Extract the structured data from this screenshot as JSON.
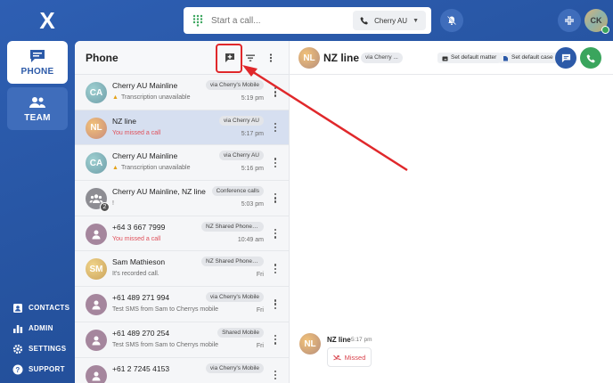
{
  "app": {
    "logo_glyph": "X",
    "accent": "#2c5aa8",
    "missed_color": "#e0505a",
    "call_green": "#3aa55d"
  },
  "nav": {
    "phone_label": "PHONE",
    "team_label": "TEAM",
    "contacts_label": "CONTACTS",
    "admin_label": "ADMIN",
    "settings_label": "SETTINGS",
    "support_label": "SUPPORT"
  },
  "topbar": {
    "search_placeholder": "Start a call...",
    "line_selector": "Cherry AU",
    "user_initials": "CK"
  },
  "phone_list": {
    "title": "Phone",
    "rows": [
      {
        "initials": "CA",
        "name": "Cherry AU Mainline",
        "tag": "via Cherry's Mobile",
        "subtitle": "Transcription unavailable",
        "time": "5:19 pm",
        "warning": true,
        "missed": false
      },
      {
        "initials": "NL",
        "name": "NZ line",
        "tag": "via Cherry AU",
        "subtitle": "You missed a call",
        "time": "5:17 pm",
        "warning": false,
        "missed": true
      },
      {
        "initials": "CA",
        "name": "Cherry AU Mainline",
        "tag": "via Cherry AU",
        "subtitle": "Transcription unavailable",
        "time": "5:16 pm",
        "warning": true,
        "missed": false
      },
      {
        "initials": "",
        "name": "Cherry AU Mainline, NZ line",
        "tag": "Conference calls",
        "subtitle": "!",
        "time": "5:03 pm",
        "warning": false,
        "missed": false,
        "badge": "2"
      },
      {
        "initials": "",
        "name": "+64 3 667 7999",
        "tag": "NZ Shared Phone Te...",
        "subtitle": "You missed a call",
        "time": "10:49 am",
        "warning": false,
        "missed": true
      },
      {
        "initials": "SM",
        "name": "Sam Mathieson",
        "tag": "NZ Shared Phone Te...",
        "subtitle": "It's recorded call.",
        "time": "Fri",
        "warning": false,
        "missed": false
      },
      {
        "initials": "",
        "name": "+61 489 271 994",
        "tag": "via Cherry's Mobile",
        "subtitle": "Test SMS from Sam to Cherrys mobile",
        "time": "Fri",
        "warning": false,
        "missed": false
      },
      {
        "initials": "",
        "name": "+61 489 270 254",
        "tag": "Shared Mobile",
        "subtitle": "Test SMS from Sam to Cherrys mobile",
        "time": "Fri",
        "warning": false,
        "missed": false
      },
      {
        "initials": "",
        "name": "+61 2 7245 4153",
        "tag": "via Cherry's Mobile",
        "subtitle": "",
        "time": "",
        "warning": false,
        "missed": false
      }
    ]
  },
  "detail": {
    "initials": "NL",
    "name": "NZ line",
    "via": "via Cherry ...",
    "set_default_matter": "Set default matter",
    "set_default_case": "Set default case",
    "message": {
      "author": "NZ line",
      "time": "5:17 pm",
      "status": "Missed"
    }
  }
}
